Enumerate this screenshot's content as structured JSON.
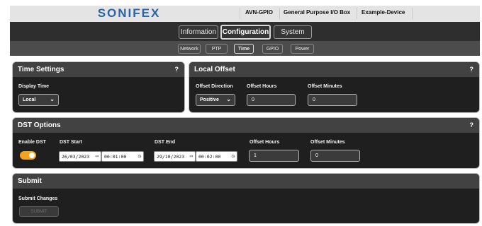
{
  "header": {
    "logo": "SONIFEX",
    "product": "AVN-GPIO",
    "description": "General Purpose I/O Box",
    "device_name": "Example-Device"
  },
  "nav": {
    "tabs": [
      "Information",
      "Configuration",
      "System"
    ],
    "active_tab": "Configuration"
  },
  "subnav": {
    "tabs": [
      "Network",
      "PTP",
      "Time",
      "GPIO",
      "Power"
    ],
    "active_tab": "Time"
  },
  "time_settings": {
    "title": "Time Settings",
    "help": "?",
    "display_time_label": "Display Time",
    "display_time_value": "Local"
  },
  "local_offset": {
    "title": "Local Offset",
    "help": "?",
    "direction_label": "Offset Direction",
    "direction_value": "Positive",
    "hours_label": "Offset Hours",
    "hours_value": "0",
    "minutes_label": "Offset Minutes",
    "minutes_value": "0"
  },
  "dst": {
    "title": "DST Options",
    "help": "?",
    "enable_label": "Enable DST",
    "enabled": true,
    "start_label": "DST Start",
    "start_date": "26/03/2023",
    "start_time": "00:01:00",
    "end_label": "DST End",
    "end_date": "29/10/2023",
    "end_time": "00:02:00",
    "hours_label": "Offset Hours",
    "hours_value": "1",
    "minutes_label": "Offset Minutes",
    "minutes_value": "0"
  },
  "submit": {
    "title": "Submit",
    "label": "Submit Changes",
    "button": "SUBMIT"
  },
  "colors": {
    "accent_toggle": "#f5a31a",
    "logo_blue": "#2a63a8",
    "panel_bg": "#1f1f1f",
    "panel_header": "#424242"
  }
}
